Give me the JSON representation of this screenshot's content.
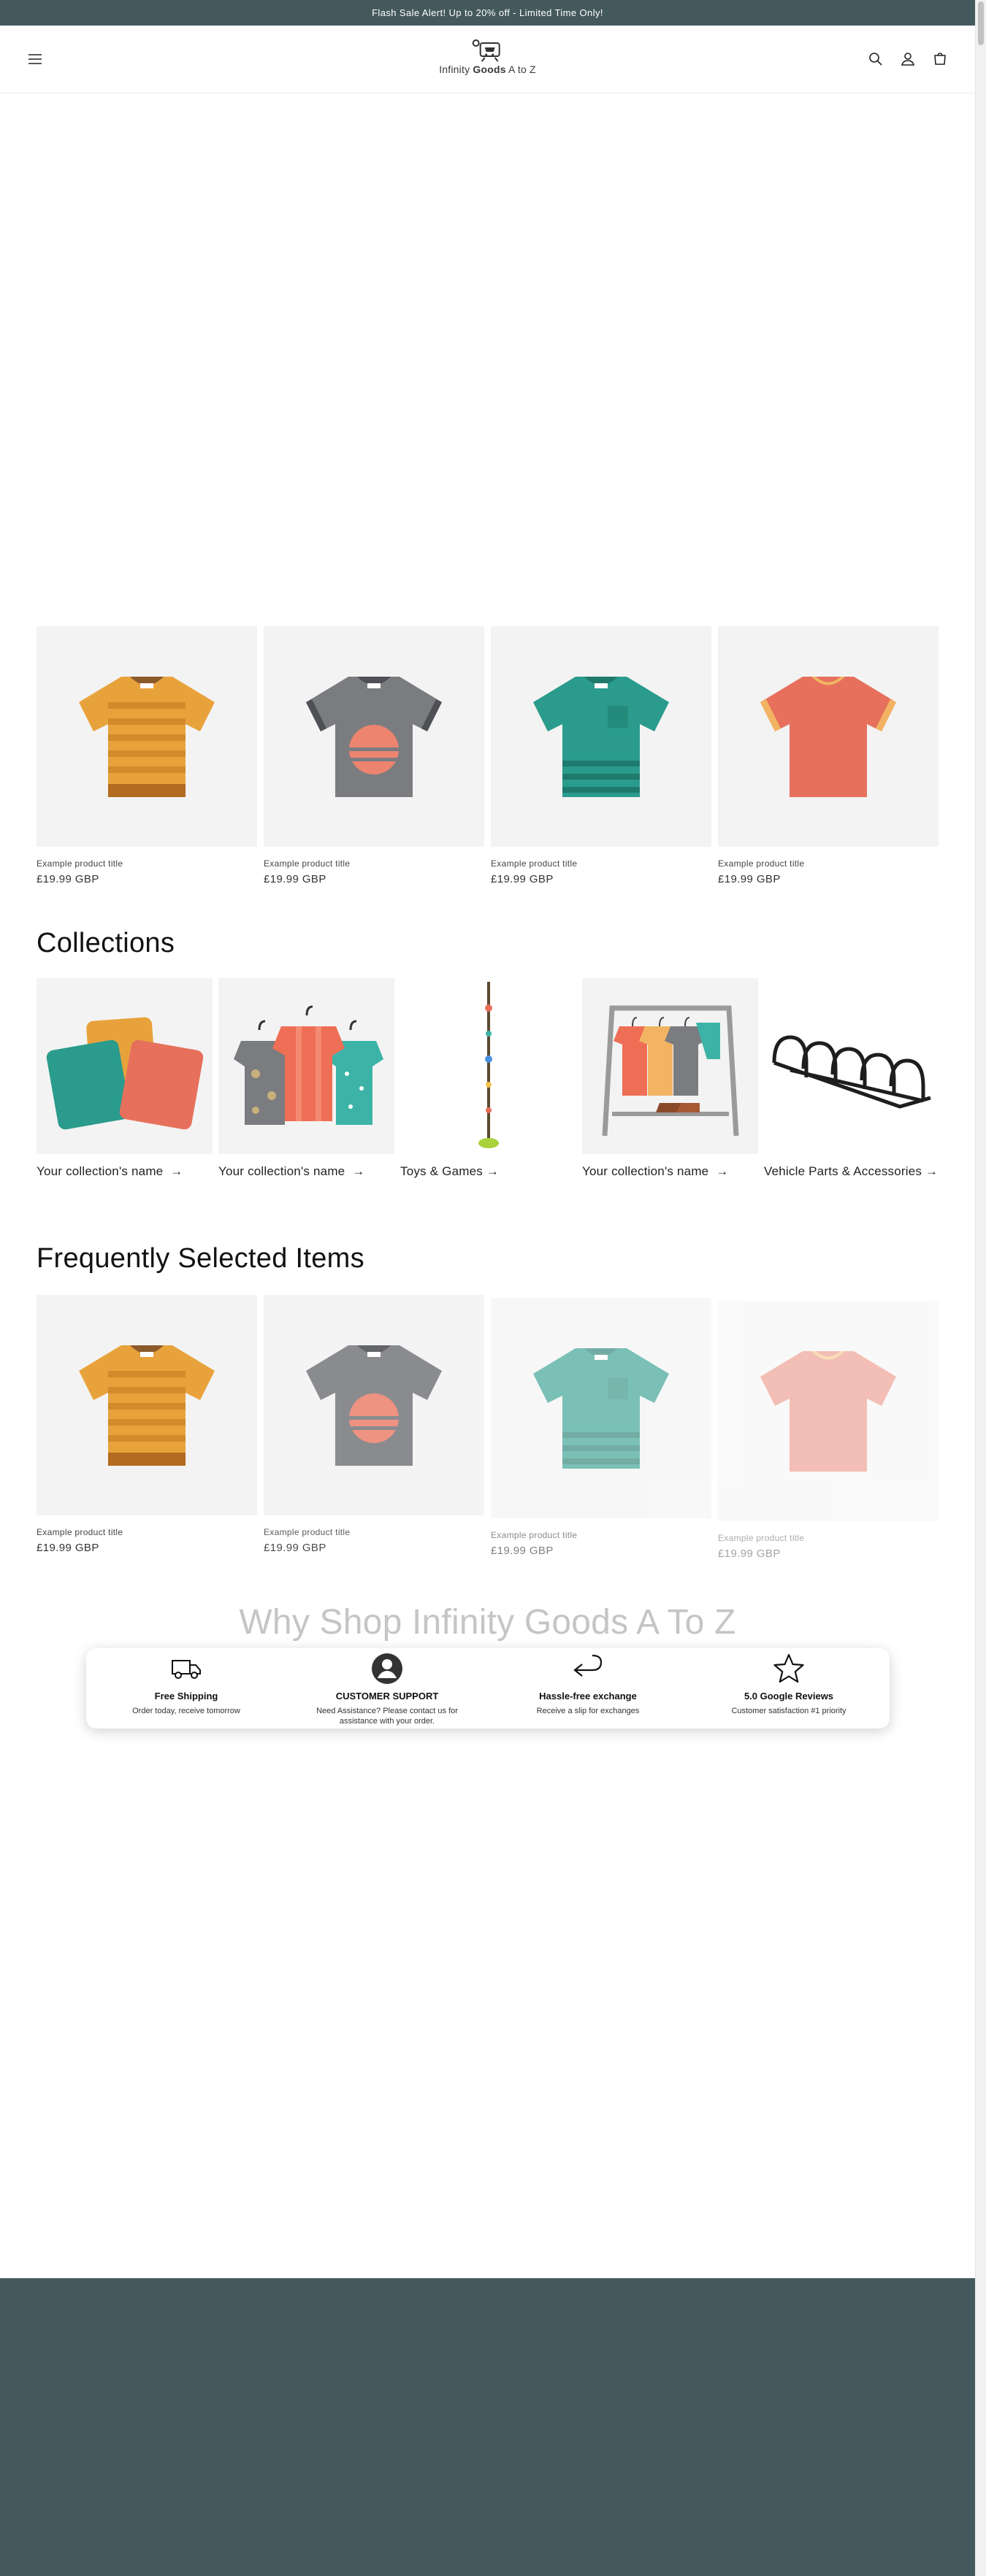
{
  "announcement": {
    "text": "Flash Sale Alert! Up to 20% off - Limited Time Only!"
  },
  "header": {
    "logo_text_1": "Infinity ",
    "logo_text_2": "Goods",
    "logo_text_3": " A to Z",
    "icons": [
      "menu-icon",
      "search-icon",
      "account-icon",
      "cart-icon"
    ]
  },
  "featured": {
    "products": [
      {
        "title": "Example product title",
        "price": "£19.99 GBP",
        "shirt": "orange-striped"
      },
      {
        "title": "Example product title",
        "price": "£19.99 GBP",
        "shirt": "grey-sunset"
      },
      {
        "title": "Example product title",
        "price": "£19.99 GBP",
        "shirt": "teal-pocket"
      },
      {
        "title": "Example product title",
        "price": "£19.99 GBP",
        "shirt": "coral"
      }
    ]
  },
  "collections": {
    "title": "Collections",
    "items": [
      {
        "label": "Your collection's name",
        "arrow": "→"
      },
      {
        "label": "Your collection's name",
        "arrow": "→"
      },
      {
        "label": "Toys & Games",
        "arrow": "→"
      },
      {
        "label": "Your collection's name",
        "arrow": "→"
      },
      {
        "label": "Vehicle Parts & Accessories",
        "arrow": "→"
      }
    ]
  },
  "frequent": {
    "title": "Frequently Selected Items",
    "products": [
      {
        "title": "Example product title",
        "price": "£19.99 GBP"
      },
      {
        "title": "Example product title",
        "price": "£19.99 GBP"
      },
      {
        "title": "Example product title",
        "price": "£19.99 GBP"
      },
      {
        "title": "Example product title",
        "price": "£19.99 GBP"
      }
    ]
  },
  "why": {
    "title": "Why Shop Infinity Goods A To Z",
    "items": [
      {
        "heading": "Free Shipping",
        "text": "Order today, receive tomorrow",
        "icon": "truck-icon"
      },
      {
        "heading": "CUSTOMER SUPPORT",
        "text": "Need Assistance? Please contact us for assistance with your order.",
        "icon": "support-icon"
      },
      {
        "heading": "Hassle-free exchange",
        "text": "Receive a slip for exchanges",
        "icon": "return-arrow-icon"
      },
      {
        "heading": "5.0 Google Reviews",
        "text": "Customer satisfaction #1 priority",
        "icon": "star-icon"
      }
    ]
  },
  "colors": {
    "brand": "#44595c",
    "card_bg": "#f3f3f3",
    "why_title": "#c5c5c5"
  }
}
